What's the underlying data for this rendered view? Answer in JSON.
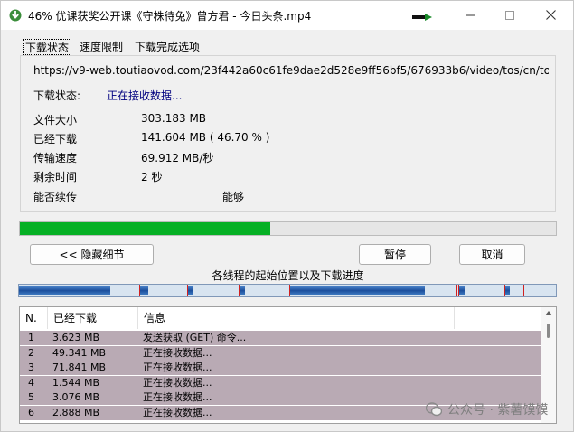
{
  "window": {
    "title": "46% 优课获奖公开课《守株待兔》曾方君 - 今日头条.mp4",
    "icons": {
      "app": "download-arrow-icon",
      "tray": "arrow-right-icon",
      "min": "minimize-icon",
      "max": "maximize-icon",
      "close": "close-icon"
    }
  },
  "tabs": [
    {
      "label": "下载状态",
      "active": true
    },
    {
      "label": "速度限制",
      "active": false
    },
    {
      "label": "下载完成选项",
      "active": false
    }
  ],
  "status": {
    "url": "https://v9-web.toutiaovod.com/23f442a60c61fe9dae2d528e9ff56bf5/676933b6/video/tos/cn/tos-cn-",
    "status_label": "下载状态:",
    "status_value": "正在接收数据...",
    "file_size_label": "文件大小",
    "file_size_value": "303.183  MB",
    "downloaded_label": "已经下载",
    "downloaded_value": "141.604  MB  ( 46.70 % )",
    "speed_label": "传输速度",
    "speed_value": "69.912  MB/秒",
    "remaining_label": "剩余时间",
    "remaining_value": "2 秒",
    "resume_label": "能否续传",
    "resume_value": "能够"
  },
  "progress": {
    "fraction": 0.467,
    "color": "#06b025"
  },
  "buttons": {
    "hide_details": "<< 隐藏细节",
    "pause": "暂停",
    "cancel": "取消"
  },
  "threads": {
    "caption": "各线程的起始位置以及下载进度",
    "segments": [
      {
        "start": 0.0,
        "filled": 0.17
      },
      {
        "start": 0.225,
        "filled": 0.015
      },
      {
        "start": 0.315,
        "filled": 0.01
      },
      {
        "start": 0.41,
        "filled": 0.01
      },
      {
        "start": 0.505,
        "filled": 0.25
      },
      {
        "start": 0.82,
        "filled": 0.01
      },
      {
        "start": 0.905,
        "filled": 0.008
      }
    ],
    "thread_starts": [
      0.0,
      0.225,
      0.315,
      0.41,
      0.505,
      0.82,
      0.905
    ]
  },
  "list": {
    "headers": [
      "N.",
      "已经下载",
      "信息",
      ""
    ],
    "rows": [
      {
        "n": "1",
        "downloaded": "3.623  MB",
        "info": "发送获取 (GET) 命令..."
      },
      {
        "n": "2",
        "downloaded": "49.341  MB",
        "info": "正在接收数据..."
      },
      {
        "n": "3",
        "downloaded": "71.841  MB",
        "info": "正在接收数据..."
      },
      {
        "n": "4",
        "downloaded": "1.544  MB",
        "info": "正在接收数据..."
      },
      {
        "n": "5",
        "downloaded": "3.076  MB",
        "info": "正在接收数据..."
      },
      {
        "n": "6",
        "downloaded": "2.888  MB",
        "info": "正在接收数据..."
      }
    ]
  },
  "watermark": {
    "text": "公众号 · 紫薯馍馍",
    "icon": "wechat-logo-icon"
  }
}
